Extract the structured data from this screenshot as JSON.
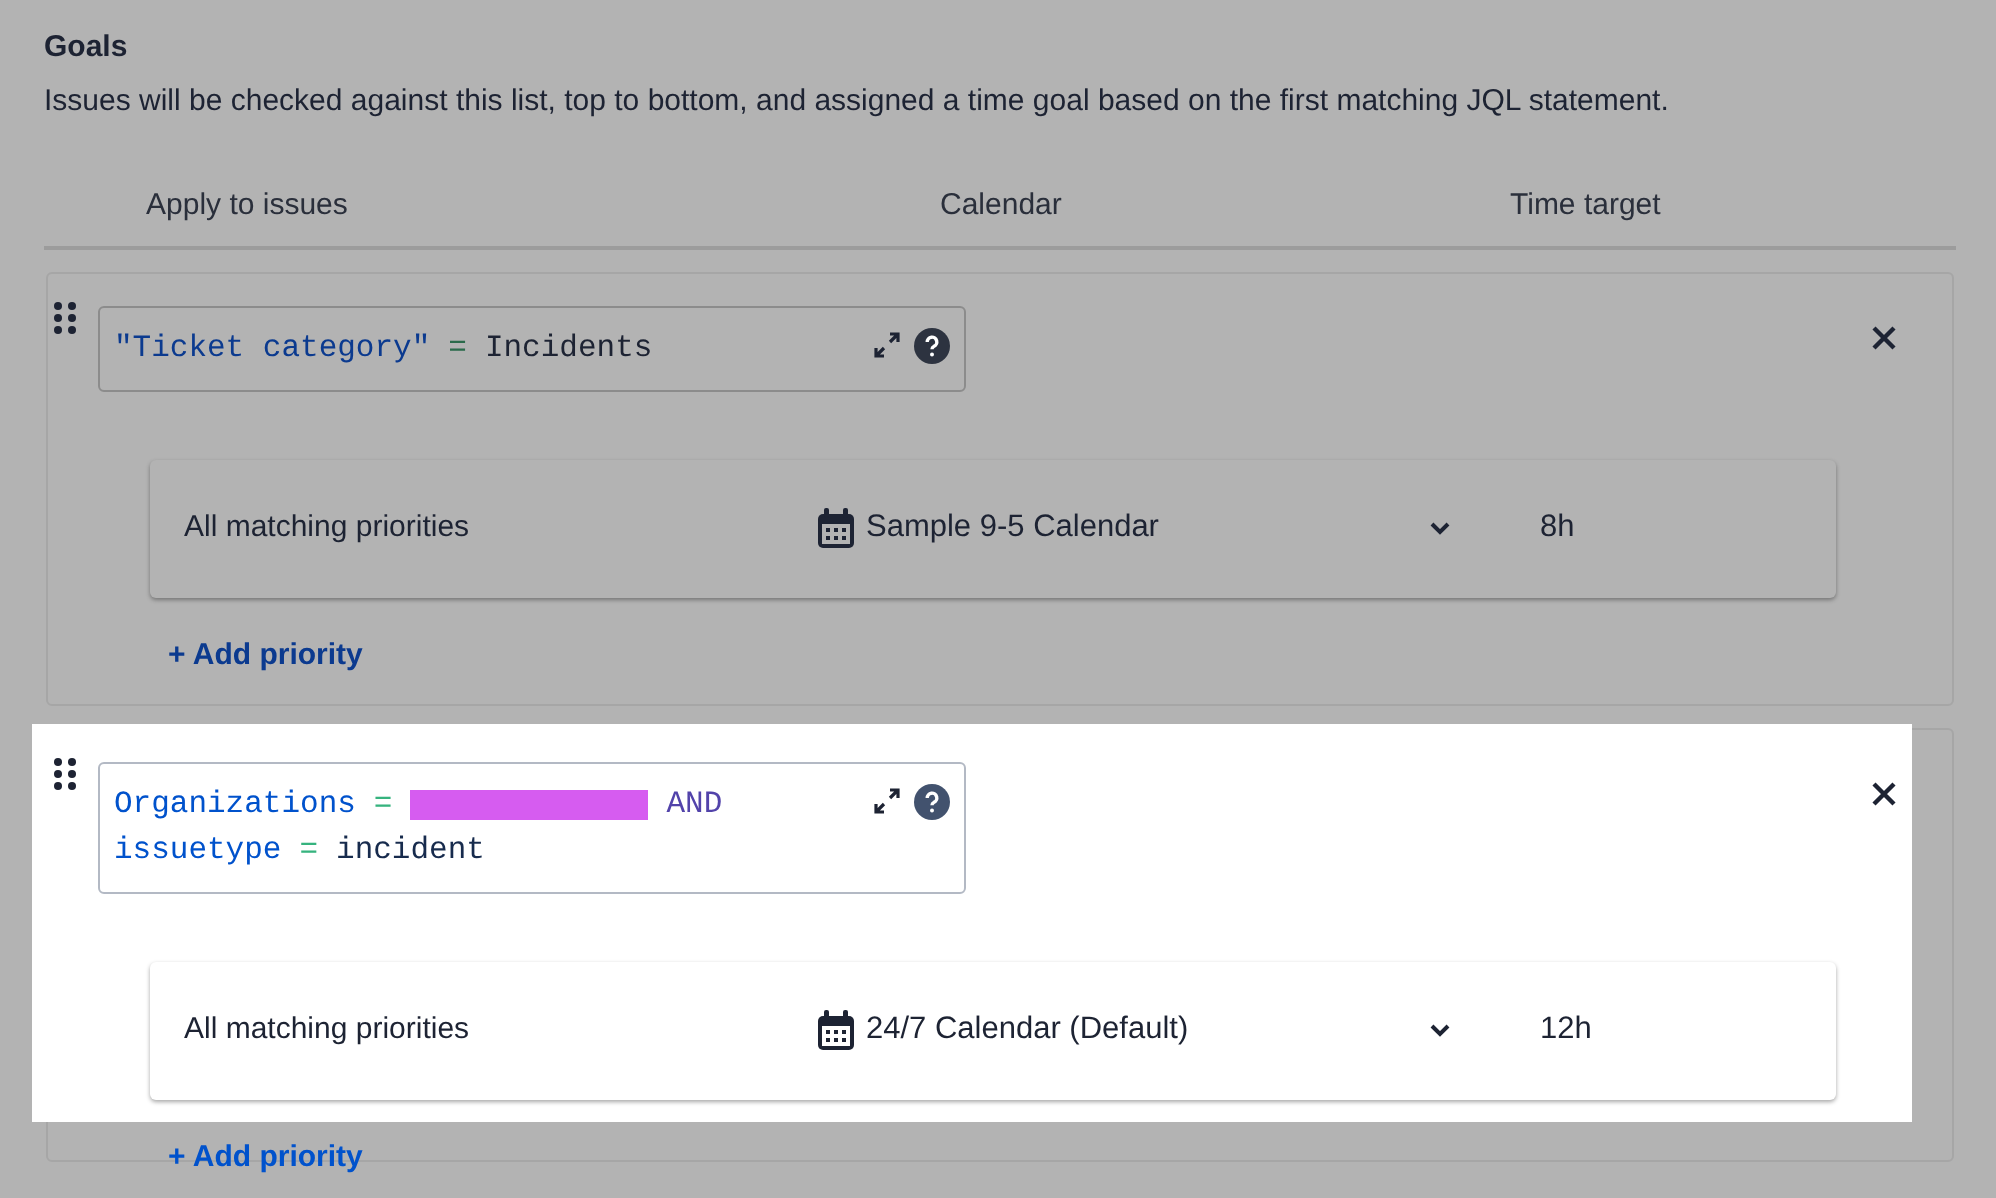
{
  "heading": "Goals",
  "description": "Issues will be checked against this list, top to bottom, and assigned a time goal based on the first matching JQL statement.",
  "columns": [
    "Apply to issues",
    "Calendar",
    "Time target"
  ],
  "goals": [
    {
      "highlighted": false,
      "jql_lines": [
        [
          {
            "kind": "field",
            "text": "\"Ticket category\""
          },
          {
            "kind": "operator",
            "text": "="
          },
          {
            "kind": "value",
            "text": "Incidents"
          }
        ]
      ],
      "priorities": [
        {
          "label": "All matching priorities",
          "calendar": "Sample 9-5 Calendar",
          "time_target": "8h"
        }
      ],
      "add_priority": "+ Add priority"
    },
    {
      "highlighted": true,
      "jql_lines": [
        [
          {
            "kind": "field",
            "text": "Organizations"
          },
          {
            "kind": "operator",
            "text": "="
          },
          {
            "kind": "redaction"
          },
          {
            "kind": "keyword",
            "text": "AND"
          }
        ],
        [
          {
            "kind": "field",
            "text": "issuetype"
          },
          {
            "kind": "operator",
            "text": "="
          },
          {
            "kind": "value",
            "text": "incident"
          }
        ]
      ],
      "priorities": [
        {
          "label": "All matching priorities",
          "calendar": "24/7 Calendar (Default)",
          "time_target": "12h"
        }
      ],
      "add_priority": "+ Add priority"
    }
  ]
}
